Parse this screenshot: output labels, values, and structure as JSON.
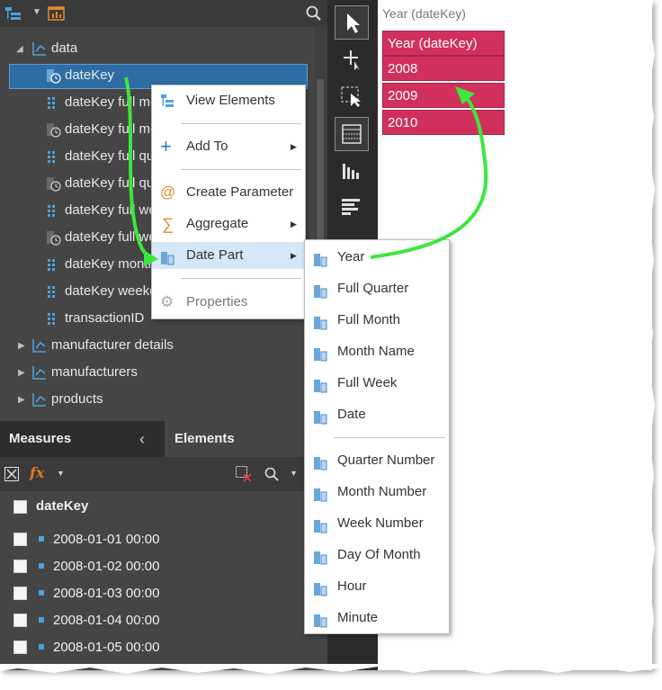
{
  "tree": {
    "root_label": "data",
    "items": [
      {
        "label": "dateKey",
        "icon": "clock-field-icon",
        "selected": true
      },
      {
        "label": "dateKey full mo",
        "icon": "grid-field-icon"
      },
      {
        "label": "dateKey full mo",
        "icon": "clock-field-icon"
      },
      {
        "label": "dateKey full qu",
        "icon": "grid-field-icon"
      },
      {
        "label": "dateKey full qu",
        "icon": "clock-field-icon"
      },
      {
        "label": "dateKey full we",
        "icon": "grid-field-icon"
      },
      {
        "label": "dateKey full we",
        "icon": "clock-field-icon"
      },
      {
        "label": "dateKey month",
        "icon": "grid-field-icon"
      },
      {
        "label": "dateKey weekd",
        "icon": "grid-field-icon"
      },
      {
        "label": "transactionID",
        "icon": "grid-field-icon"
      }
    ],
    "groups": [
      {
        "label": "manufacturer details"
      },
      {
        "label": "manufacturers"
      },
      {
        "label": "products"
      }
    ]
  },
  "context_menu": {
    "items": [
      {
        "label": "View Elements",
        "icon": "hierarchy-icon",
        "submenu": false
      },
      {
        "label": "Add To",
        "icon": "plus-icon",
        "submenu": true
      },
      {
        "label": "Create Parameter",
        "icon": "at-icon",
        "submenu": false
      },
      {
        "label": "Aggregate",
        "icon": "sigma-icon",
        "submenu": true
      },
      {
        "label": "Date Part",
        "icon": "date-part-icon",
        "submenu": true,
        "highlighted": true
      },
      {
        "label": "Properties",
        "icon": "gear-icon",
        "submenu": false
      }
    ]
  },
  "date_part_menu": {
    "items": [
      "Year",
      "Full Quarter",
      "Full Month",
      "Month Name",
      "Full Week",
      "Date",
      "Quarter Number",
      "Month Number",
      "Week Number",
      "Day Of Month",
      "Hour",
      "Minute"
    ]
  },
  "tabs": {
    "measures": "Measures",
    "elements": "Elements"
  },
  "elements": {
    "header": "dateKey",
    "rows": [
      "2008-01-01 00:00",
      "2008-01-02 00:00",
      "2008-01-03 00:00",
      "2008-01-04 00:00",
      "2008-01-05 00:00"
    ]
  },
  "canvas": {
    "title": "Year (dateKey)",
    "table_header": "Year (dateKey)",
    "rows": [
      "2008",
      "2009",
      "2010"
    ]
  },
  "colors": {
    "accent_green": "#3ee63e",
    "table_red": "#d2305c",
    "selection_blue": "#2e6da4",
    "menu_highlight": "#d6e8f8"
  }
}
